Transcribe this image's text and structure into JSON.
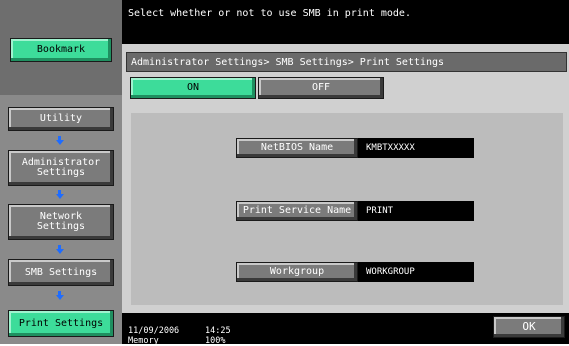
{
  "message": "Select whether or not to use SMB in print mode.",
  "sidebar": {
    "bookmark": "Bookmark",
    "utility": "Utility",
    "admin_settings": "Administrator Settings",
    "network_settings": "Network Settings",
    "smb_settings": "SMB Settings",
    "print_settings": "Print Settings"
  },
  "header": {
    "breadcrumb": "Administrator Settings> SMB Settings> Print Settings"
  },
  "toggle": {
    "on": "ON",
    "off": "OFF",
    "selected": "ON"
  },
  "fields": {
    "netbios_label": "NetBIOS Name",
    "netbios_value": "KMBTXXXXX",
    "print_service_label": "Print Service Name",
    "print_service_value": "PRINT",
    "workgroup_label": "Workgroup",
    "workgroup_value": "WORKGROUP"
  },
  "status": {
    "date": "11/09/2006",
    "time": "14:25",
    "memory_label": "Memory",
    "memory_value": "100%"
  },
  "ok_label": "OK",
  "colors": {
    "accent_green": "#3ddc9a",
    "arrow_blue": "#1e6cff"
  }
}
